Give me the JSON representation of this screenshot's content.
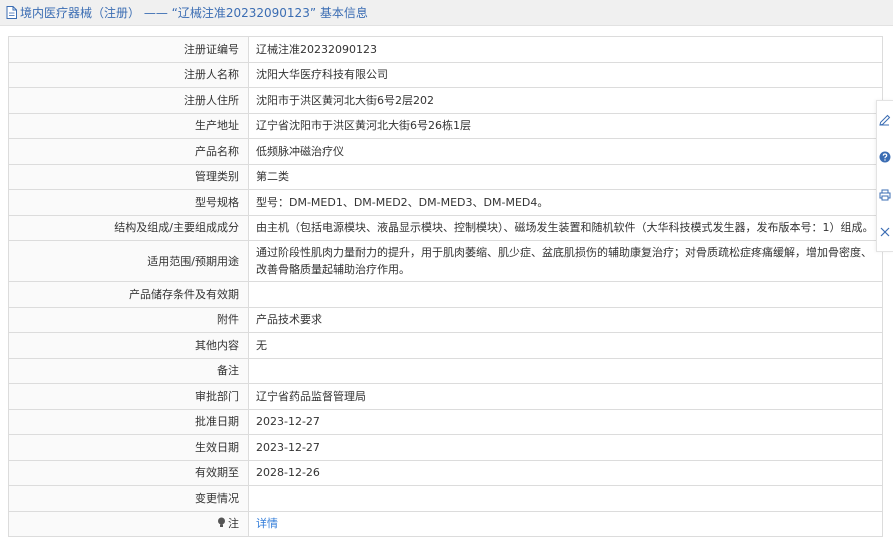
{
  "header": {
    "title": "境内医疗器械（注册） —— “辽械注准20232090123” 基本信息"
  },
  "rows": [
    {
      "label": "注册证编号",
      "value": "辽械注准20232090123"
    },
    {
      "label": "注册人名称",
      "value": "沈阳大华医疗科技有限公司"
    },
    {
      "label": "注册人住所",
      "value": "沈阳市于洪区黄河北大街6号2层202"
    },
    {
      "label": "生产地址",
      "value": "辽宁省沈阳市于洪区黄河北大街6号26栋1层"
    },
    {
      "label": "产品名称",
      "value": "低频脉冲磁治疗仪"
    },
    {
      "label": "管理类别",
      "value": "第二类"
    },
    {
      "label": "型号规格",
      "value": "型号：DM-MED1、DM-MED2、DM-MED3、DM-MED4。"
    },
    {
      "label": "结构及组成/主要组成成分",
      "value": "由主机（包括电源模块、液晶显示模块、控制模块）、磁场发生装置和随机软件（大华科技模式发生器，发布版本号：1）组成。"
    },
    {
      "label": "适用范围/预期用途",
      "value": "通过阶段性肌肉力量耐力的提升，用于肌肉萎缩、肌少症、盆底肌损伤的辅助康复治疗；对骨质疏松症疼痛缓解，增加骨密度、改善骨骼质量起辅助治疗作用。"
    },
    {
      "label": "产品储存条件及有效期",
      "value": ""
    },
    {
      "label": "附件",
      "value": "产品技术要求"
    },
    {
      "label": "其他内容",
      "value": "无"
    },
    {
      "label": "备注",
      "value": ""
    },
    {
      "label": "审批部门",
      "value": "辽宁省药品监督管理局"
    },
    {
      "label": "批准日期",
      "value": "2023-12-27"
    },
    {
      "label": "生效日期",
      "value": "2023-12-27"
    },
    {
      "label": "有效期至",
      "value": "2028-12-26"
    },
    {
      "label": "变更情况",
      "value": ""
    }
  ],
  "note_row": {
    "label": "注",
    "link_text": "详情"
  },
  "colors": {
    "accent": "#3b6db3",
    "link": "#2f7bd9",
    "border": "#dcdcdc"
  },
  "toolbar_icons": [
    "edit-icon",
    "help-icon",
    "print-icon",
    "close-icon"
  ]
}
